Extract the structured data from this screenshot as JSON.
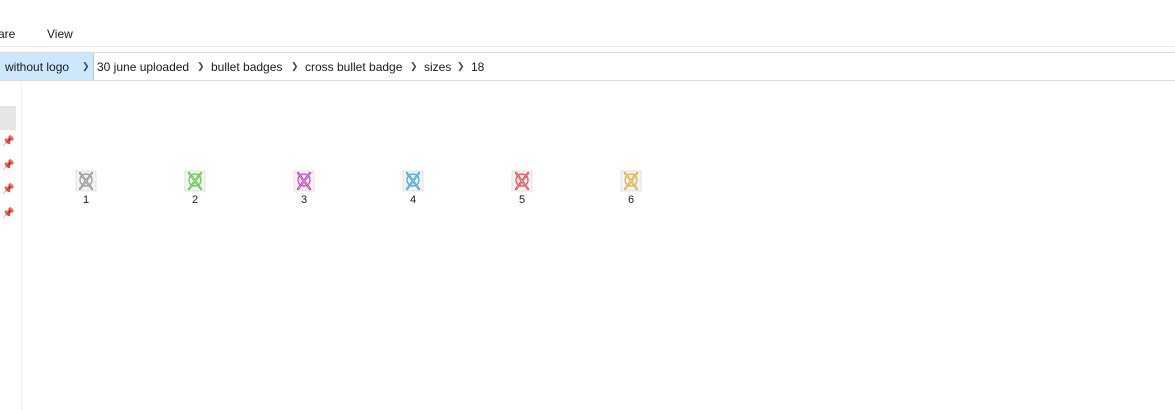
{
  "ribbon": {
    "tabs": [
      "are",
      "View"
    ]
  },
  "breadcrumb": [
    "without logo",
    "30 june uploaded",
    "bullet badges",
    "cross bullet badge",
    "sizes",
    "18"
  ],
  "files": [
    {
      "name": "1",
      "color": "#8a8a8a",
      "icon": "cross-bullet-badge-icon"
    },
    {
      "name": "2",
      "color": "#4fc230",
      "icon": "cross-bullet-badge-icon"
    },
    {
      "name": "3",
      "color": "#d12bb0",
      "icon": "cross-bullet-badge-icon"
    },
    {
      "name": "4",
      "color": "#2b9fd6",
      "icon": "cross-bullet-badge-icon"
    },
    {
      "name": "5",
      "color": "#e03c3c",
      "icon": "cross-bullet-badge-icon"
    },
    {
      "name": "6",
      "color": "#e0a82b",
      "icon": "cross-bullet-badge-icon"
    }
  ],
  "colors": {
    "selection": "#cce8ff",
    "nav_selected": "#e5e5e5"
  }
}
